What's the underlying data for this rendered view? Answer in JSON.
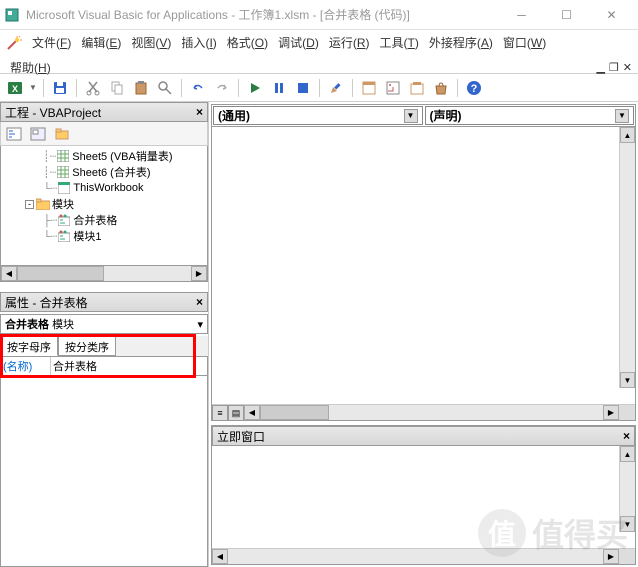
{
  "window": {
    "title": "Microsoft Visual Basic for Applications - 工作簿1.xlsm - [合并表格 (代码)]"
  },
  "menu": {
    "file": "文件",
    "file_k": "F",
    "edit": "编辑",
    "edit_k": "E",
    "view": "视图",
    "view_k": "V",
    "insert": "插入",
    "insert_k": "I",
    "format": "格式",
    "format_k": "O",
    "debug": "调试",
    "debug_k": "D",
    "run": "运行",
    "run_k": "R",
    "tools": "工具",
    "tools_k": "T",
    "addins": "外接程序",
    "addins_k": "A",
    "window": "窗口",
    "window_k": "W",
    "help": "帮助",
    "help_k": "H"
  },
  "project": {
    "title": "工程 - VBAProject",
    "nodes": {
      "sheet5": "Sheet5 (VBA销量表)",
      "sheet6": "Sheet6 (合并表)",
      "thiswb": "ThisWorkbook",
      "modules": "模块",
      "mod1": "合并表格",
      "mod2": "模块1"
    }
  },
  "properties": {
    "title": "属性 - 合并表格",
    "object_name": "合并表格",
    "object_type": "模块",
    "tab_alpha": "按字母序",
    "tab_cat": "按分类序",
    "name_key": "(名称)",
    "name_val": "合并表格"
  },
  "code": {
    "left_combo": "(通用)",
    "right_combo": "(声明)"
  },
  "immediate": {
    "title": "立即窗口"
  },
  "watermark": "值得买"
}
